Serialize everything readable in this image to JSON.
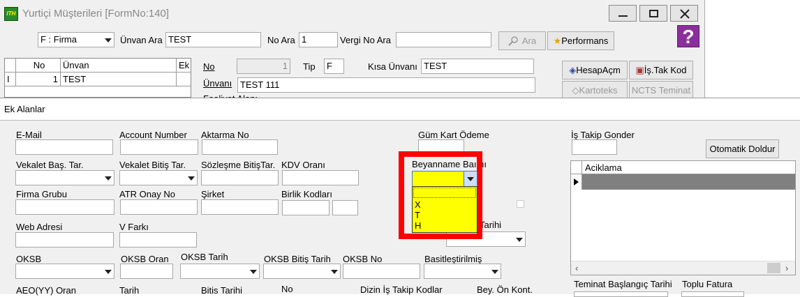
{
  "window": {
    "title": "Yurtiçi Müşterileri [FormNo:140]",
    "app_icon_text": "ITH"
  },
  "search": {
    "field_select": "F : Firma",
    "unvan_label": "Ünvan Ara",
    "unvan_value": "TEST",
    "no_label": "No Ara",
    "no_value": "1",
    "vergi_label": "Vergi No Ara",
    "vergi_value": "",
    "ara_button": "Ara",
    "performans_button": "Performans"
  },
  "grid": {
    "headers": [
      "No",
      "Ünvan",
      "Ek"
    ],
    "rows": [
      {
        "marker": "I",
        "no": "1",
        "unvan": "TEST"
      }
    ]
  },
  "record": {
    "no_label": "No",
    "no_value": "1",
    "tip_label": "Tip",
    "tip_value": "F",
    "kisa_label": "Kısa Ünvanı",
    "kisa_value": "TEST",
    "unvan_label": "Ünvanı",
    "unvan_value": "TEST 111",
    "hidden_label": "Faaliyet Alanı"
  },
  "side_buttons": {
    "hesapacm": "HesapAçm",
    "istakkod": "İş.Tak Kod",
    "kartoteks": "Kartoteks",
    "ncts": "NCTS Teminat"
  },
  "panel": {
    "title": "Ek Alanlar",
    "labels": {
      "email": "E-Mail",
      "account": "Account Number",
      "aktarma": "Aktarma No",
      "gumkart": "Güm Kart Ödeme",
      "istakip": "İş Takip Gonder",
      "vekbas": "Vekalet Baş. Tar.",
      "vekbit": "Vekalet Bitiş Tar.",
      "sozbit": "Sözleşme BitişTar.",
      "kdv": "KDV Oranı",
      "beyanname": "Beyanname Baımı",
      "firmagrubu": "Firma Grubu",
      "atr": "ATR Onay No",
      "sirket": "Şirket",
      "birlik": "Birlik Kodları",
      "web": "Web Adresi",
      "vfarki": "V Farkı",
      "tarihi": "Tarihi",
      "oksb": "OKSB",
      "oksboran": "OKSB Oran",
      "oksbtarih": "OKSB Tarih",
      "oksbbitis": "OKSB Bitiş Tarih",
      "oksbno": "OKSB No",
      "basit": "Basitleştirilmiş",
      "aeo": "AEO(YY)  Oran",
      "tarih": "Tarih",
      "bitistarihi": "Bitis Tarihi",
      "no": "No",
      "dizin": "Dizin İş Takip Kodlar",
      "beyon": "Bey. Ön Kont.",
      "teminat": "Teminat Başlangıç Tarihi",
      "toplu": "Toplu Fatura"
    },
    "otomatik_button": "Otomatik Doldur",
    "aciklama_header": "Aciklama",
    "dropdown_options": [
      "X",
      "T",
      "H"
    ]
  },
  "colors": {
    "highlight_border": "#ff0000",
    "dropdown_bg": "#ffff00",
    "help_icon": "#8b2f9c"
  }
}
